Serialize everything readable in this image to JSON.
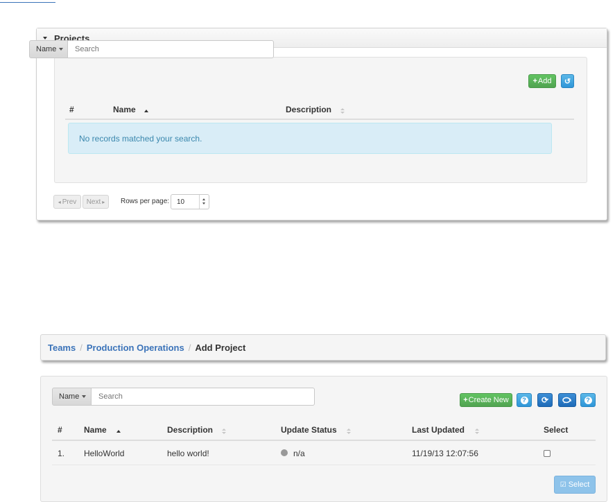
{
  "projects_panel": {
    "title": "Projects",
    "search": {
      "field_label": "Name",
      "placeholder": "Search"
    },
    "add_label": "Add",
    "columns": {
      "number": "#",
      "name": "Name",
      "description": "Description"
    },
    "empty_message": "No records matched your search.",
    "pager": {
      "prev": "Prev",
      "next": "Next",
      "rows_label": "Rows per page:",
      "rows_value": "10"
    }
  },
  "breadcrumb": {
    "items": [
      "Teams",
      "Production Operations"
    ],
    "separator": "/",
    "active": "Add Project"
  },
  "project_table": {
    "search": {
      "field_label": "Name",
      "placeholder": "Search"
    },
    "create_label": "Create New",
    "columns": {
      "number": "#",
      "name": "Name",
      "description": "Description",
      "update_status": "Update Status",
      "last_updated": "Last Updated",
      "select": "Select"
    },
    "rows": [
      {
        "number": "1.",
        "name": "HelloWorld",
        "description": "hello world!",
        "status": "n/a",
        "last_updated": "11/19/13 12:07:56",
        "selected": false
      }
    ],
    "select_button": "Select"
  },
  "colors": {
    "link": "#3b73b9",
    "success": "#51a351",
    "info": "#2f96d8",
    "alert_bg": "#d9edf7",
    "alert_text": "#3a87ad"
  }
}
